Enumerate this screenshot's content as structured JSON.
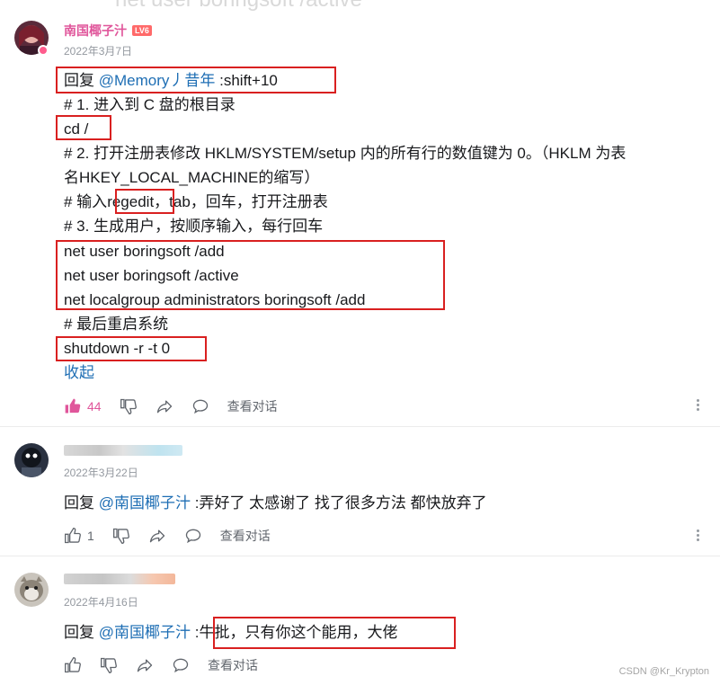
{
  "ghost_top_text": "net user boringsoft /active",
  "comments": [
    {
      "username": "南国椰子汁",
      "level_badge": "LV6",
      "date": "2022年3月7日",
      "reply_prefix": "回复",
      "mention": "@Memory丿昔年",
      "lines": [
        ":shift+10",
        "# 1. 进入到 C 盘的根目录",
        "cd /",
        "# 2. 打开注册表修改 HKLM/SYSTEM/setup 内的所有行的数值键为 0。（HKLM 为表",
        "名HKEY_LOCAL_MACHINE的缩写）",
        "# 输入",
        "regedit",
        "，tab，回车，打开注册表",
        "# 3. 生成用户，按顺序输入，每行回车",
        "net user boringsoft /add",
        "net user boringsoft /active",
        "net localgroup administrators boringsoft /add",
        "# 最后重启系统",
        "shutdown -r -t 0"
      ],
      "collapse_label": "收起",
      "like_count": "44",
      "view_dialog": "查看对话",
      "icons": [
        "thumbs-up-icon",
        "thumbs-down-icon",
        "share-icon",
        "reply-bubble-icon",
        "more-vertical-icon"
      ]
    },
    {
      "date": "2022年3月22日",
      "reply_prefix": "回复",
      "mention": "@南国椰子汁",
      "text": ":弄好了 太感谢了 找了很多方法 都快放弃了",
      "like_count": "1",
      "view_dialog": "查看对话"
    },
    {
      "date": "2022年4月16日",
      "reply_prefix": "回复",
      "mention": "@南国椰子汁",
      "separator": ":",
      "text": "牛批，只有你这个能用，大佬",
      "view_dialog": "查看对话"
    }
  ],
  "watermark": "CSDN @Kr_Krypton",
  "colors": {
    "mention": "#1e6eb4",
    "username": "#e0569b",
    "like_active": "#e0569b",
    "highlight_box": "#d92020"
  }
}
